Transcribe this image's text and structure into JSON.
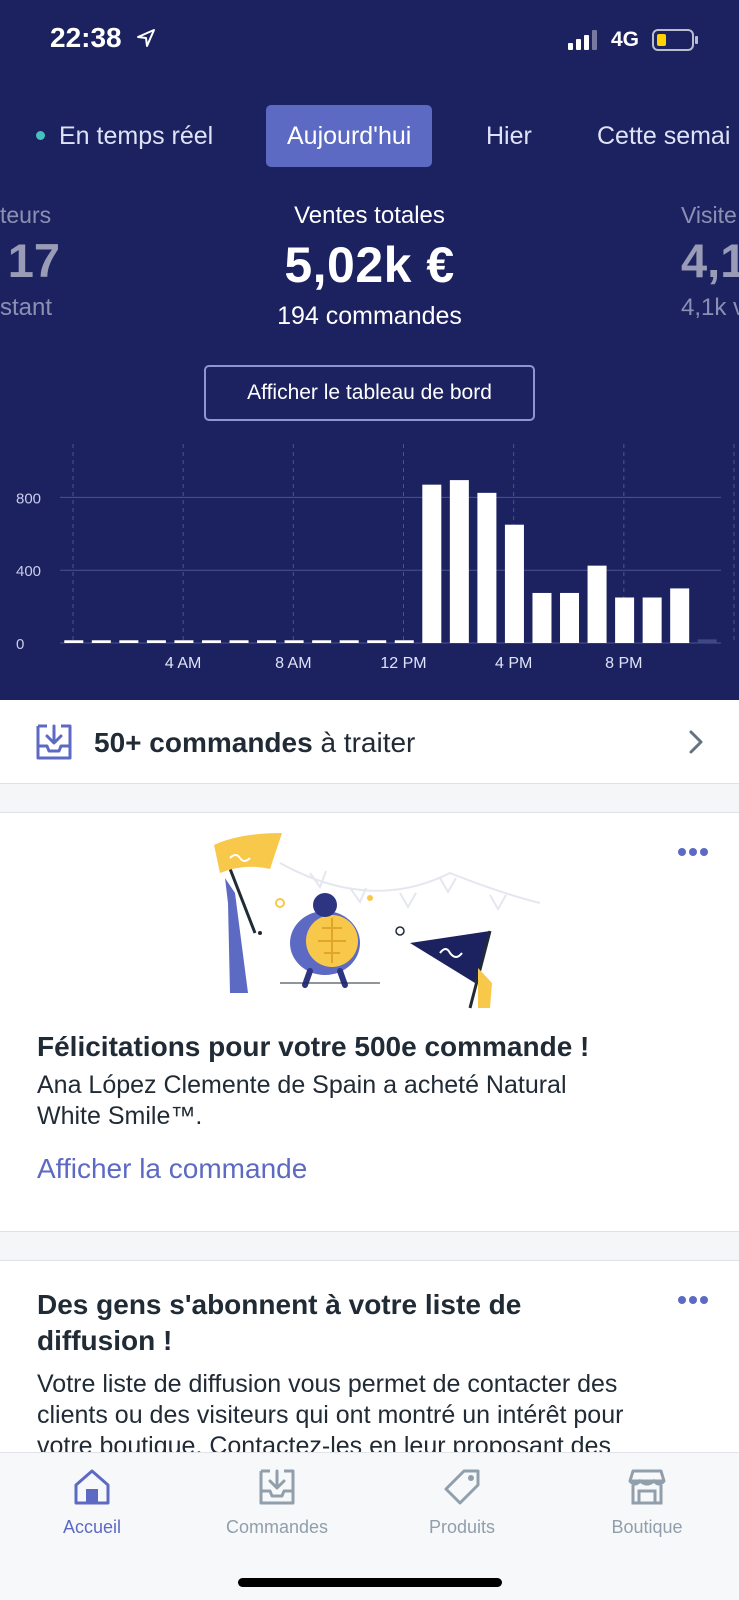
{
  "status_bar": {
    "time": "22:38",
    "network": "4G"
  },
  "tabs": [
    {
      "label": "En temps réel",
      "active": false
    },
    {
      "label": "Aujourd'hui",
      "active": true
    },
    {
      "label": "Hier",
      "active": false
    },
    {
      "label": "Cette semai",
      "active": false
    }
  ],
  "metrics": {
    "left": {
      "label": "teurs",
      "value": "17",
      "sub": "stant"
    },
    "center": {
      "label": "Ventes totales",
      "value": "5,02k €",
      "sub": "194 commandes"
    },
    "right": {
      "label": "Visite",
      "value": "4,1",
      "sub": "4,1k v"
    }
  },
  "dashboard_button": "Afficher le tableau de bord",
  "chart_data": {
    "type": "bar",
    "categories": [
      "12 AM",
      "1 AM",
      "2 AM",
      "3 AM",
      "4 AM",
      "5 AM",
      "6 AM",
      "7 AM",
      "8 AM",
      "9 AM",
      "10 AM",
      "11 AM",
      "12 PM",
      "1 PM",
      "2 PM",
      "3 PM",
      "4 PM",
      "5 PM",
      "6 PM",
      "7 PM",
      "8 PM",
      "9 PM",
      "10 PM",
      "11 PM"
    ],
    "values": [
      15,
      15,
      15,
      15,
      15,
      15,
      15,
      15,
      15,
      15,
      15,
      15,
      15,
      870,
      895,
      825,
      650,
      275,
      275,
      425,
      250,
      250,
      300,
      20
    ],
    "x_tick_labels": [
      "4 AM",
      "8 AM",
      "12 PM",
      "4 PM",
      "8 PM"
    ],
    "y_tick_labels": [
      "0",
      "400",
      "800"
    ],
    "ylim": [
      0,
      1000
    ],
    "grid": true,
    "bar_color": "#ffffff",
    "last_bar_color": "#3f4884"
  },
  "tasks": {
    "bold": "50+ commandes",
    "rest": " à traiter"
  },
  "card1": {
    "title": "Félicitations pour votre 500e commande !",
    "body_line1": "Ana López Clemente de Spain a acheté Natural",
    "body_line2": "White Smile™.",
    "link": "Afficher la commande"
  },
  "card2": {
    "title_line1": "Des gens s'abonnent à votre liste de",
    "title_line2": "diffusion !",
    "body_line1": "Votre liste de diffusion vous permet de contacter des",
    "body_line2": "clients ou des visiteurs qui ont montré un intérêt pour",
    "body_line3": "votre boutique. Contactez-les en leur proposant des"
  },
  "bottom_nav": [
    {
      "label": "Accueil",
      "icon": "home-icon",
      "active": true
    },
    {
      "label": "Commandes",
      "icon": "orders-icon",
      "active": false
    },
    {
      "label": "Produits",
      "icon": "tag-icon",
      "active": false
    },
    {
      "label": "Boutique",
      "icon": "store-icon",
      "active": false
    }
  ],
  "colors": {
    "hero_bg": "#1c2260",
    "accent": "#5c6ac4",
    "live_dot": "#47c1bf",
    "battery": "#ffd200"
  }
}
